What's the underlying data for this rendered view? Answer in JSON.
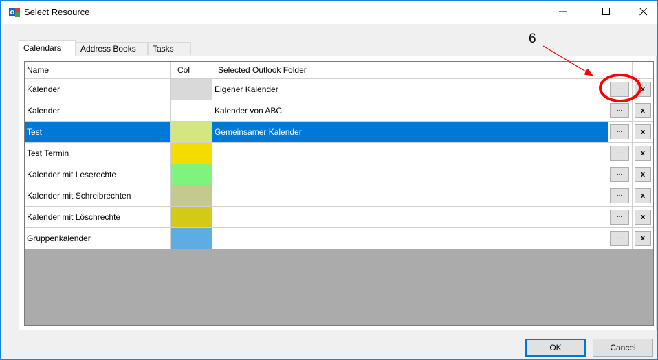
{
  "window": {
    "title": "Select Resource",
    "app_icon": "outlook-addin-icon",
    "controls": {
      "minimize": "minimize-icon",
      "maximize": "maximize-icon",
      "close": "close-icon"
    }
  },
  "tabs": [
    {
      "label": "Calendars",
      "active": true
    },
    {
      "label": "Address Books",
      "active": false
    },
    {
      "label": "Tasks",
      "active": false
    }
  ],
  "grid": {
    "headers": {
      "name": "Name",
      "col": "Col",
      "folder": "Selected Outlook Folder"
    },
    "rows": [
      {
        "name": "Kalender",
        "color": "#d9d9d9",
        "folder": "Eigener Kalender",
        "selected": false,
        "browse": "...",
        "remove": "x"
      },
      {
        "name": "Kalender",
        "color": "#ffffff",
        "folder": "Kalender von ABC",
        "selected": false,
        "browse": "...",
        "remove": "x"
      },
      {
        "name": "Test",
        "color": "#d4e67e",
        "folder": "Gemeinsamer Kalender",
        "selected": true,
        "browse": "...",
        "remove": "x"
      },
      {
        "name": "Test Termin",
        "color": "#f4dc00",
        "folder": "",
        "selected": false,
        "browse": "...",
        "remove": "x"
      },
      {
        "name": "Kalender mit Leserechte",
        "color": "#80f37c",
        "folder": "",
        "selected": false,
        "browse": "...",
        "remove": "x"
      },
      {
        "name": "Kalender mit Schreibrechten",
        "color": "#c4c98e",
        "folder": "",
        "selected": false,
        "browse": "...",
        "remove": "x"
      },
      {
        "name": "Kalender mit Löschrechte",
        "color": "#d3c917",
        "folder": "",
        "selected": false,
        "browse": "...",
        "remove": "x"
      },
      {
        "name": "Gruppenkalender",
        "color": "#5dade2",
        "folder": "",
        "selected": false,
        "browse": "...",
        "remove": "x"
      }
    ]
  },
  "annotation": {
    "number": "6",
    "color": "#ff0000"
  },
  "buttons": {
    "ok": "OK",
    "cancel": "Cancel"
  },
  "colors": {
    "selection": "#0078d7",
    "empty_grid": "#ababab",
    "annotation": "#ff0000"
  }
}
